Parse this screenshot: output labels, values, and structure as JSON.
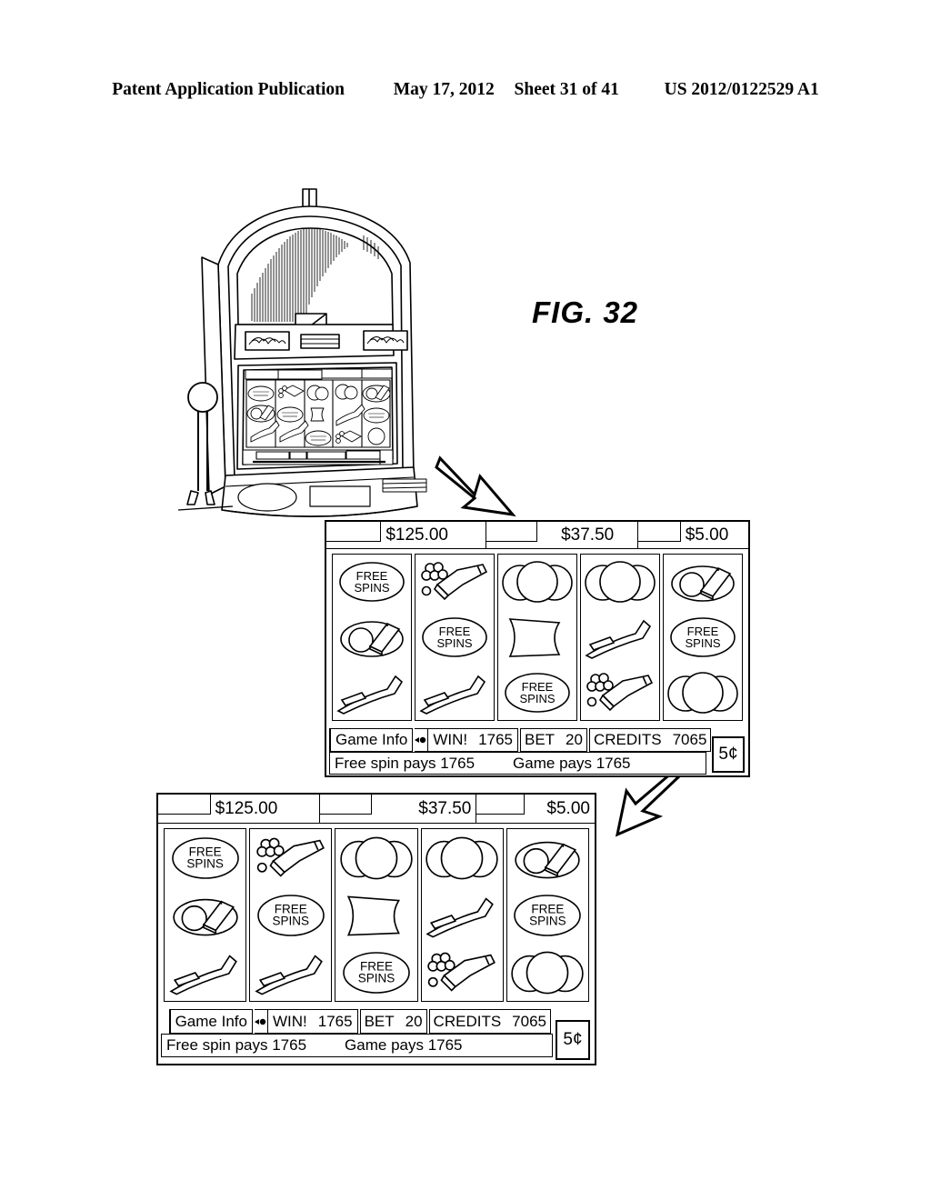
{
  "header": {
    "publication": "Patent Application Publication",
    "date": "May 17, 2012",
    "sheet": "Sheet 31 of 41",
    "docnum": "US 2012/0122529 A1"
  },
  "figure": {
    "label": "FIG. 32"
  },
  "cabinet": {
    "name": "slot-machine-cabinet"
  },
  "upper_display": {
    "jackpots": [
      {
        "value": "",
        "kind": "tab"
      },
      {
        "value": "$125.00",
        "kind": "meter"
      },
      {
        "value": "",
        "kind": "tab"
      },
      {
        "value": "$37.50",
        "kind": "meter"
      },
      {
        "value": "",
        "kind": "tab"
      },
      {
        "value": "$5.00",
        "kind": "meter"
      }
    ],
    "reels": [
      [
        "free-spins",
        "book-ball",
        "sword"
      ],
      [
        "cannon",
        "free-spins",
        "sword"
      ],
      [
        "coins",
        "flag",
        "free-spins"
      ],
      [
        "coins",
        "sword",
        "cannon"
      ],
      [
        "book-ball",
        "free-spins",
        "coins"
      ]
    ],
    "free_spins_text_line1": "FREE",
    "free_spins_text_line2": "SPINS",
    "status": {
      "game_info": "Game Info",
      "win_label": "WIN!",
      "win_value": "1765",
      "bet_label": "BET",
      "bet_value": "20",
      "credits_label": "CREDITS",
      "credits_value": "7065",
      "message_left": "Free spin pays 1765",
      "message_right": "Game pays 1765",
      "denomination": "5¢"
    }
  },
  "lower_display": {
    "jackpots": [
      {
        "value": "",
        "kind": "tab"
      },
      {
        "value": "$125.00",
        "kind": "meter"
      },
      {
        "value": "",
        "kind": "tab"
      },
      {
        "value": "$37.50",
        "kind": "meter"
      },
      {
        "value": "",
        "kind": "tab"
      },
      {
        "value": "$5.00",
        "kind": "meter"
      }
    ],
    "reels": [
      [
        "free-spins",
        "book-ball",
        "sword"
      ],
      [
        "cannon",
        "free-spins",
        "sword"
      ],
      [
        "coins",
        "flag",
        "free-spins"
      ],
      [
        "coins",
        "sword",
        "cannon"
      ],
      [
        "book-ball",
        "free-spins",
        "coins"
      ]
    ],
    "free_spins_text_line1": "FREE",
    "free_spins_text_line2": "SPINS",
    "status": {
      "game_info": "Game Info",
      "win_label": "WIN!",
      "win_value": "1765",
      "bet_label": "BET",
      "bet_value": "20",
      "credits_label": "CREDITS",
      "credits_value": "7065",
      "message_left": "Free spin pays 1765",
      "message_right": "Game pays 1765",
      "denomination": "5¢"
    }
  },
  "arrows": [
    {
      "name": "arrow-cabinet-to-upper",
      "direction": "down-right"
    },
    {
      "name": "arrow-upper-to-lower",
      "direction": "down-left"
    }
  ],
  "colors": {
    "ink": "#000000",
    "paper": "#ffffff"
  }
}
